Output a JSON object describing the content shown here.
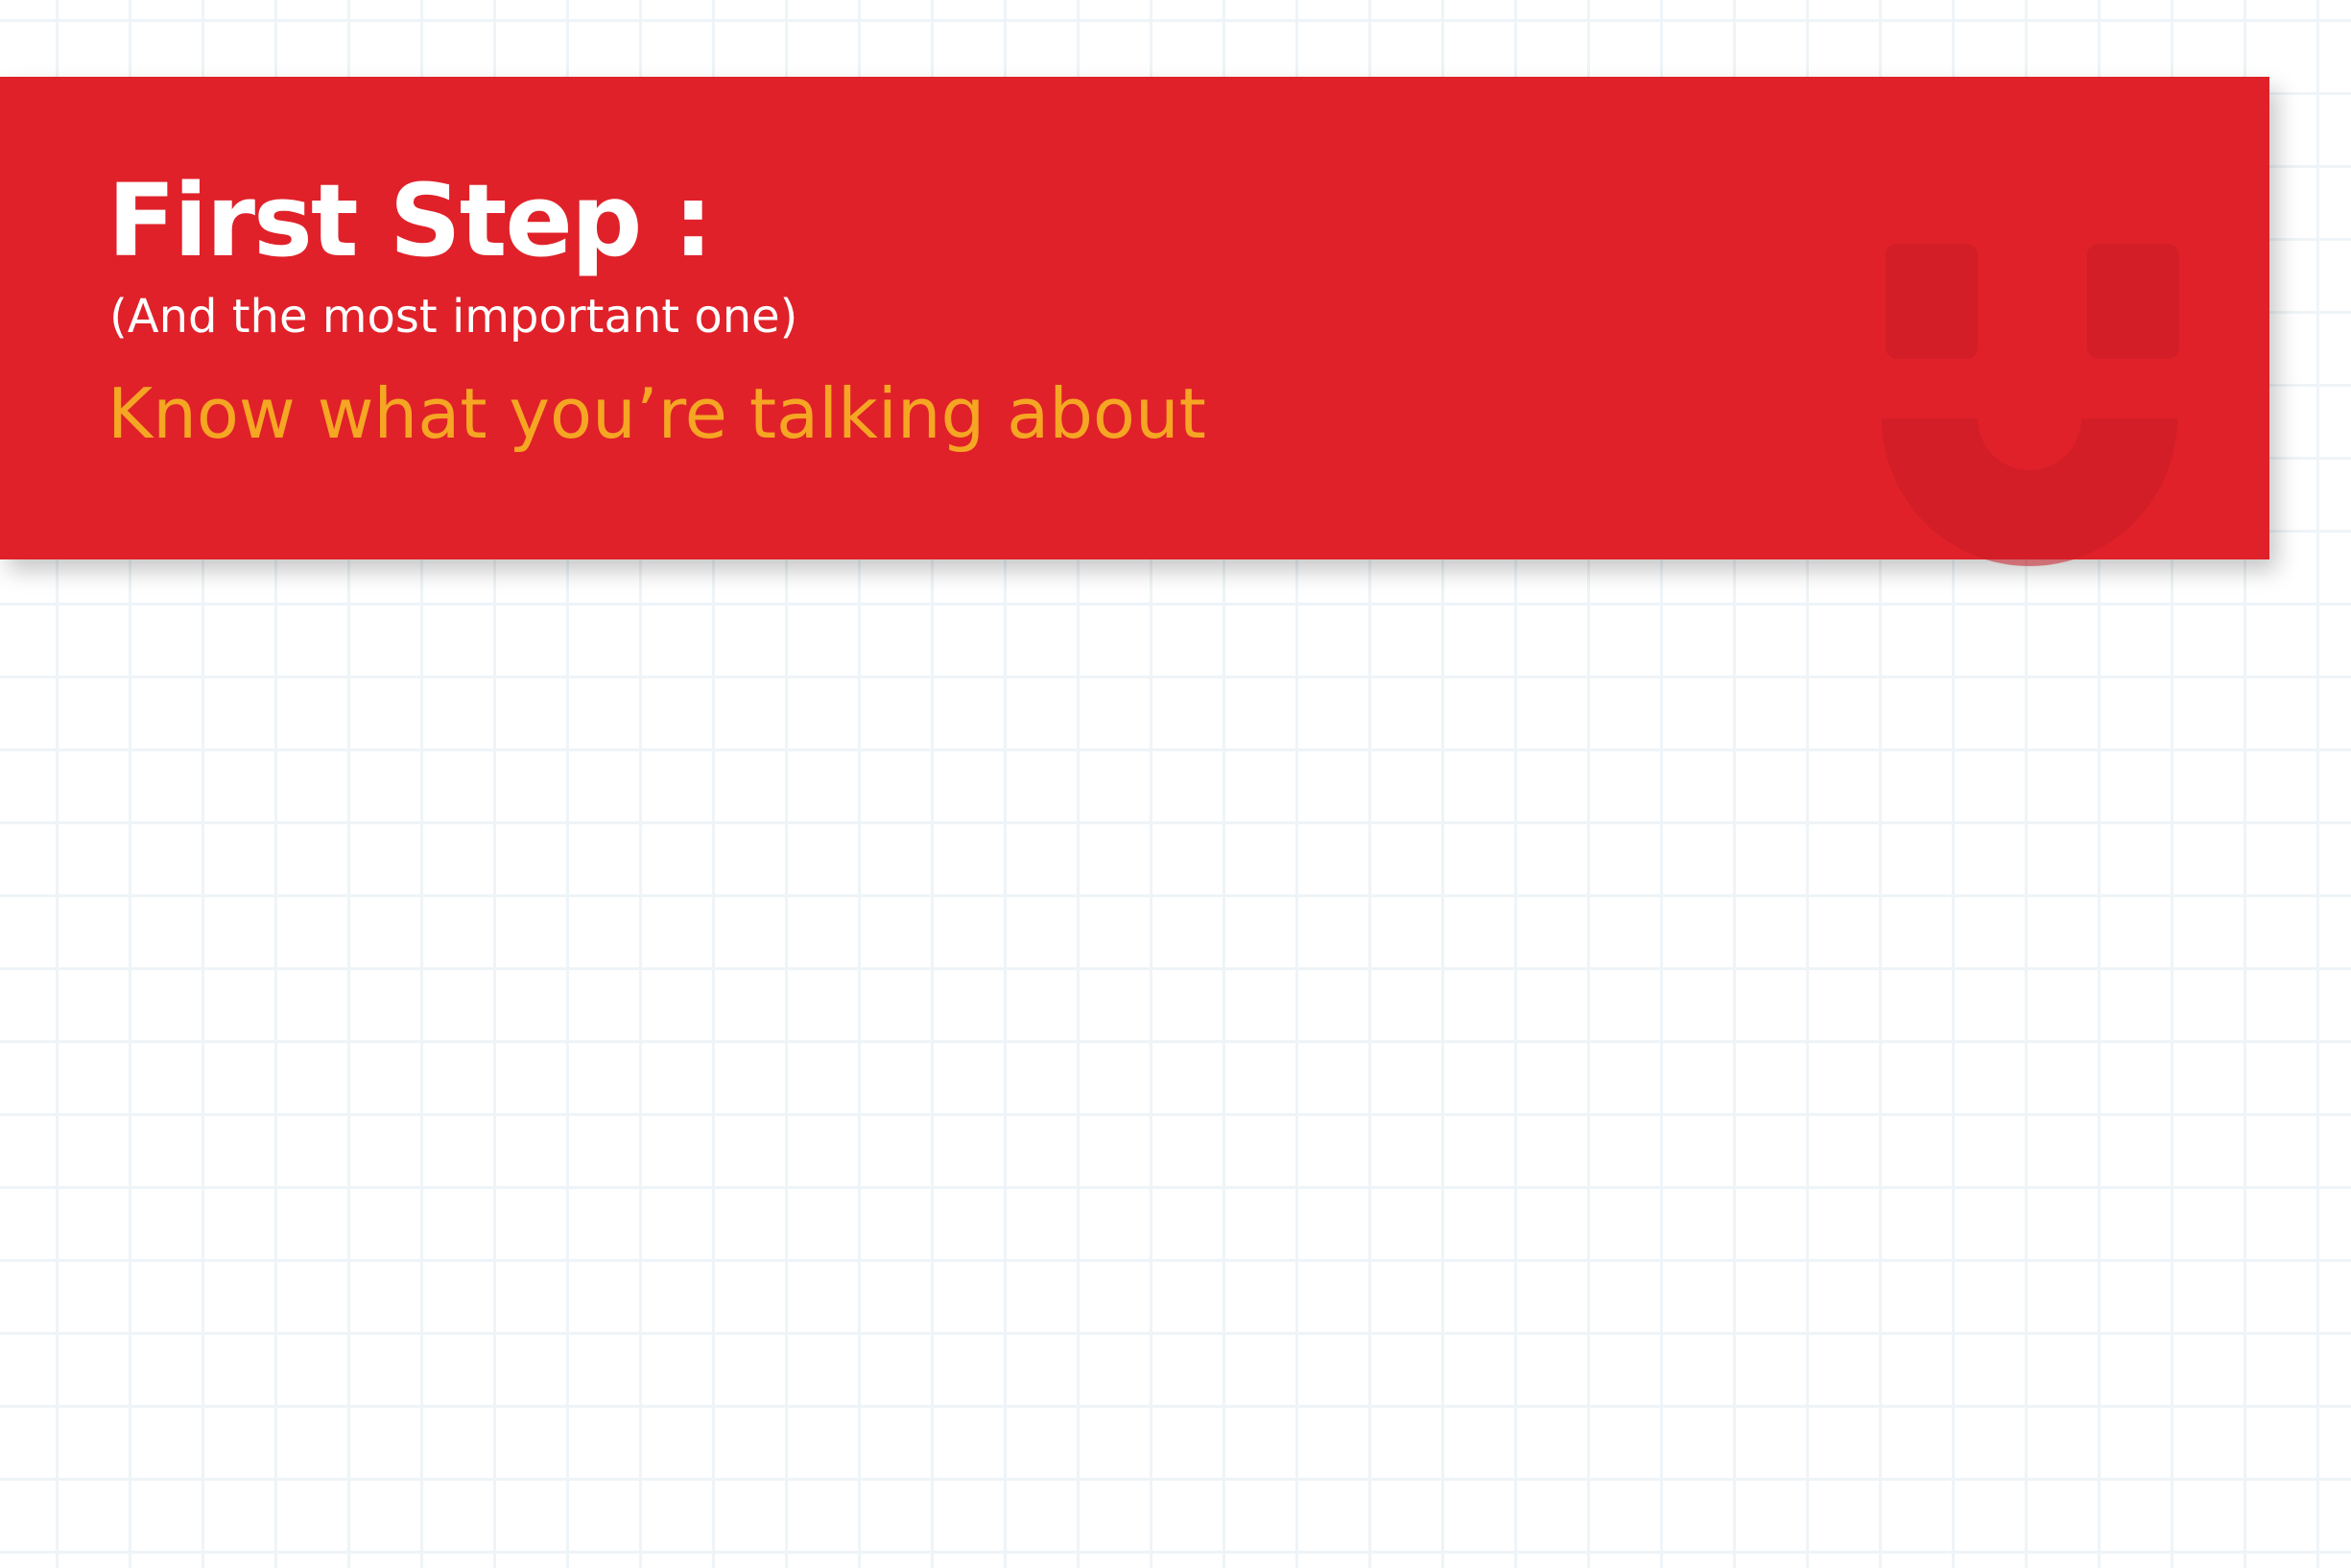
{
  "banner": {
    "title": "First Step :",
    "subtitle": "(And the most important one)",
    "tagline": "Know what you’re talking about"
  },
  "icons": {
    "watermark": "smiley-face-icon"
  },
  "colors": {
    "banner_background": "#e02129",
    "title_text": "#ffffff",
    "subtitle_text": "#ffffff",
    "tagline_text": "#f5a623",
    "watermark": "#c91d26",
    "grid_lines": "#eef4f7",
    "page_background": "#ffffff"
  }
}
